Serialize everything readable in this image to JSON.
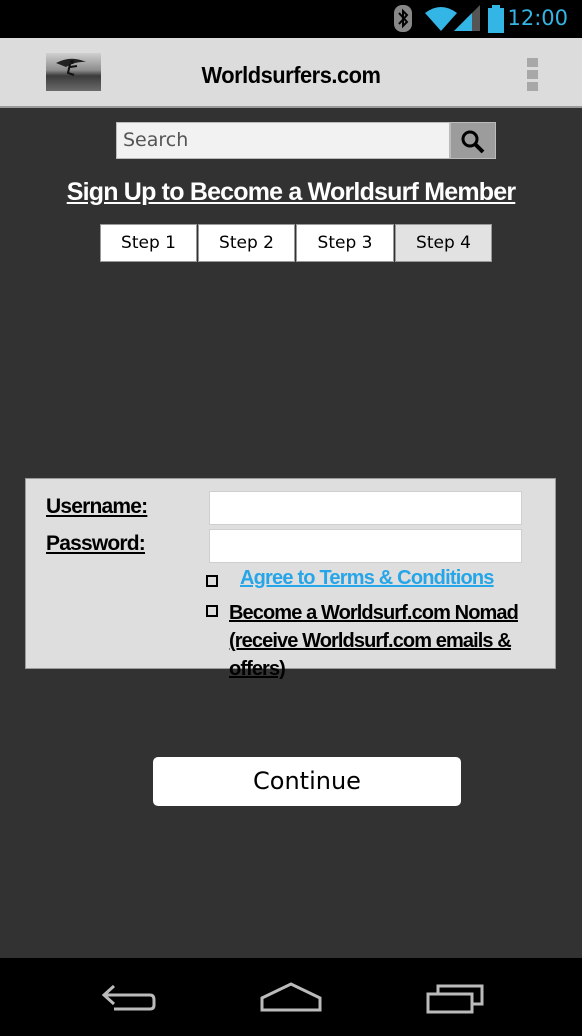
{
  "status_bar": {
    "time": "12:00"
  },
  "app_bar": {
    "title": "Worldsurfers.com"
  },
  "search": {
    "placeholder": "Search"
  },
  "heading": "Sign Up to Become a Worldsurf Member",
  "steps": [
    {
      "label": "Step 1"
    },
    {
      "label": "Step 2"
    },
    {
      "label": "Step 3"
    },
    {
      "label": "Step 4",
      "active": true
    }
  ],
  "form": {
    "username_label": "Username:",
    "password_label": "Password:",
    "username_value": "",
    "password_value": "",
    "terms_link": "Agree to Terms & Conditions",
    "nomad_line1": "Become a Worldsurf.com Nomad",
    "nomad_line2": "(receive Worldsurf.com emails & offers)"
  },
  "continue_label": "Continue",
  "colors": {
    "background": "#323232",
    "link": "#26a6e8",
    "status_accent": "#33b5e5"
  },
  "icons": [
    "bluetooth-icon",
    "wifi-icon",
    "signal-icon",
    "battery-icon",
    "search-icon",
    "overflow-menu-icon",
    "back-icon",
    "home-icon",
    "recents-icon"
  ]
}
